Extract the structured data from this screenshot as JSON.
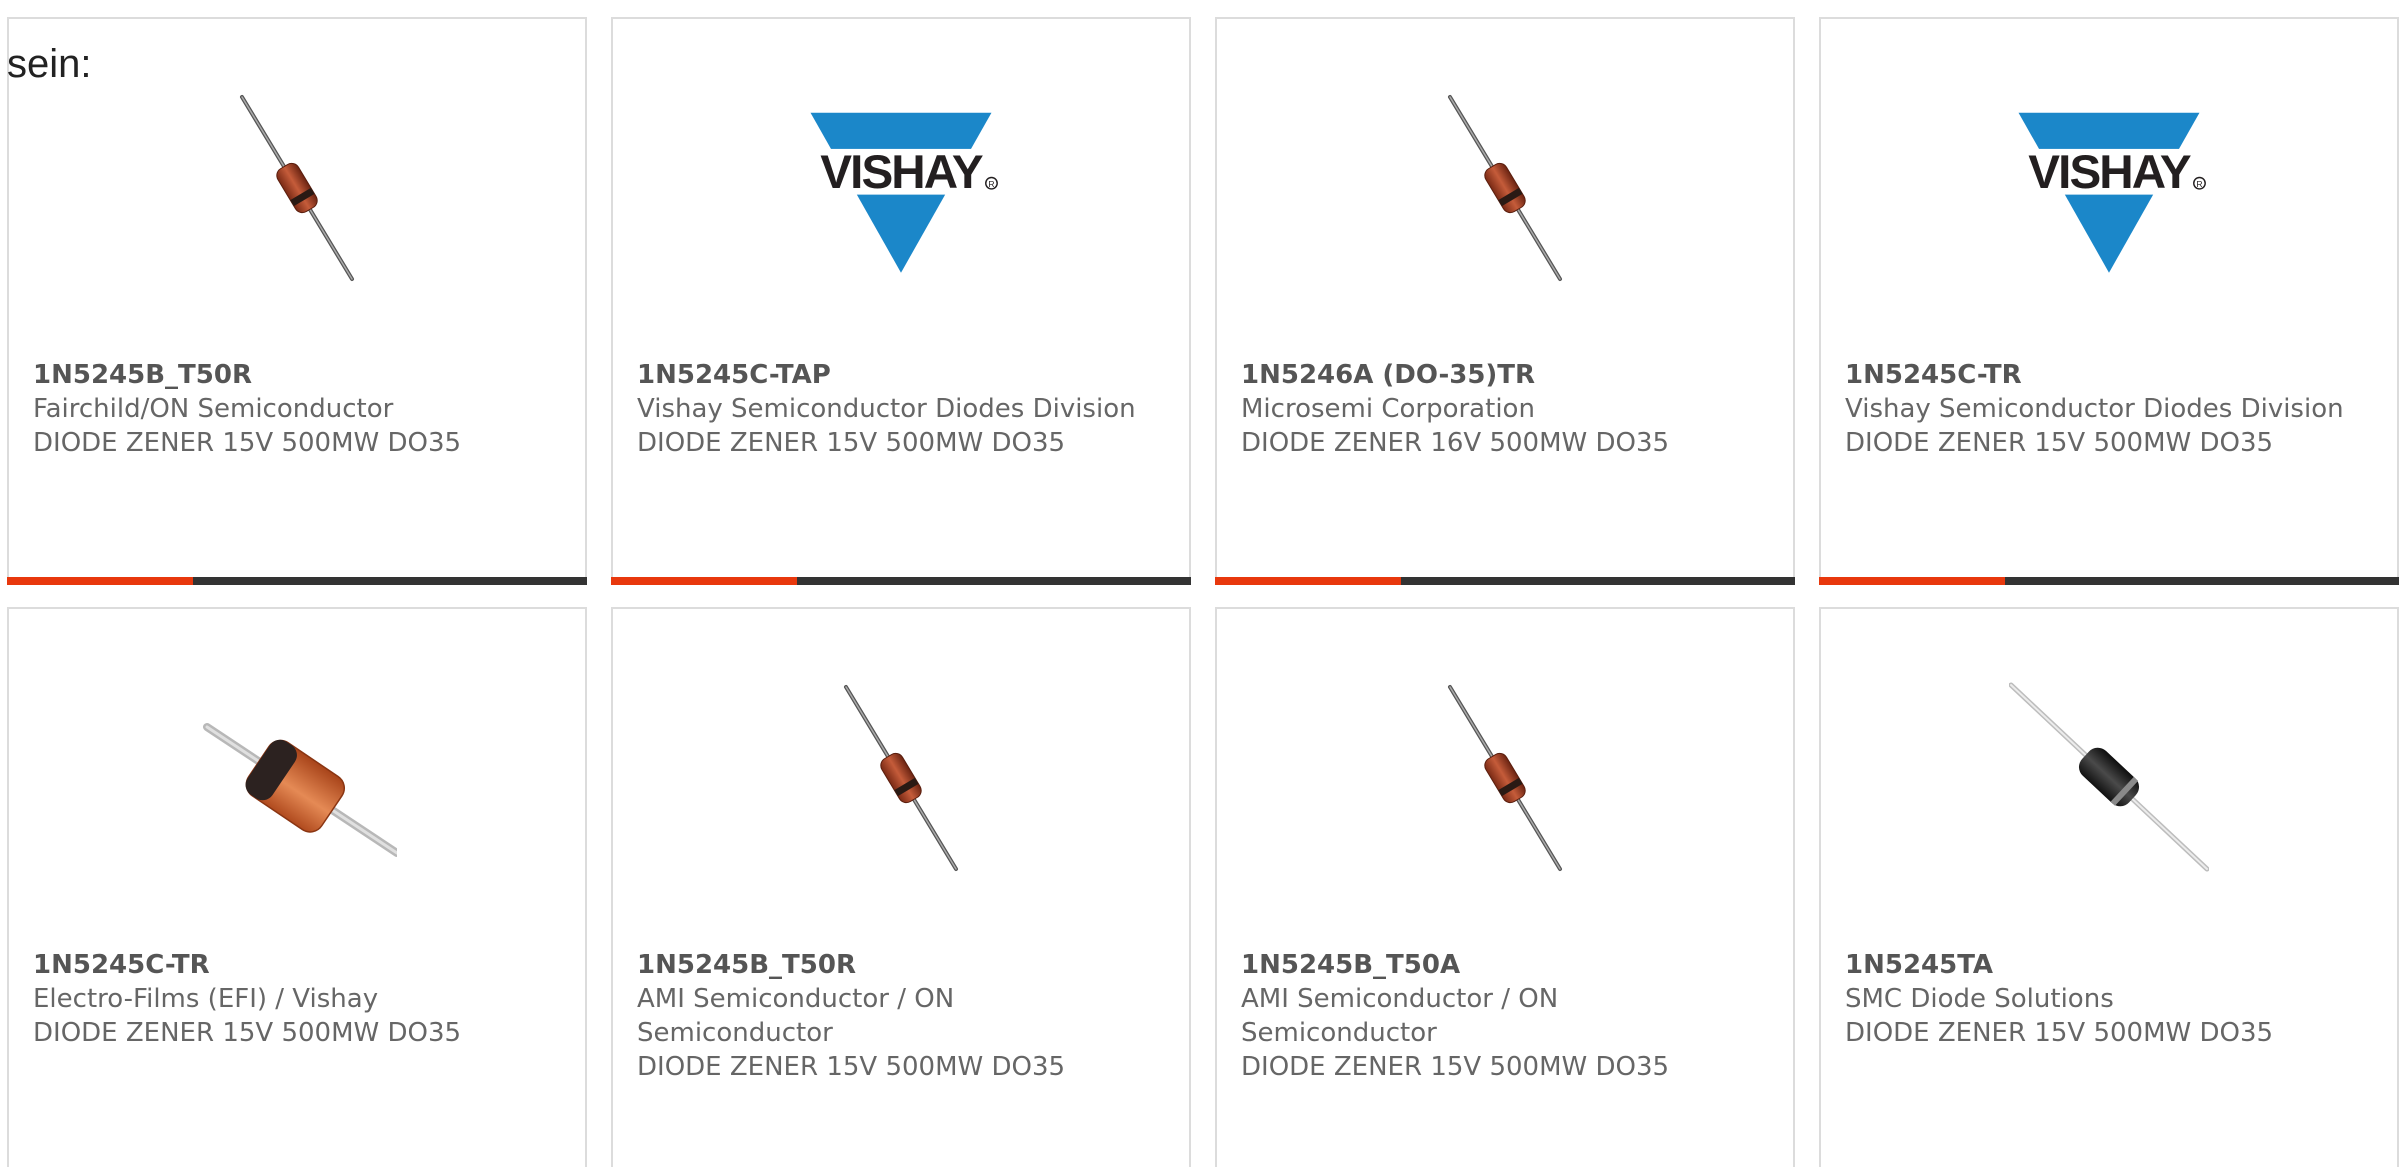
{
  "intro_text": "sein:",
  "colors": {
    "accent": "#e8380d",
    "bar_dark": "#333333",
    "card_border": "#dcdcdc",
    "vishay_blue": "#1b87c9"
  },
  "accent_bar_fraction": 0.32,
  "products": [
    {
      "part_number": "1N5245B_T50R",
      "manufacturer": "Fairchild/ON Semiconductor",
      "description": "DIODE ZENER 15V 500MW DO35",
      "image": "diode-do35-thin-icon"
    },
    {
      "part_number": "1N5245C-TAP",
      "manufacturer": "Vishay Semiconductor Diodes Division",
      "description": "DIODE ZENER 15V 500MW DO35",
      "image": "vishay-logo",
      "logo_text": "VISHAY"
    },
    {
      "part_number": "1N5246A (DO-35)TR",
      "manufacturer": "Microsemi Corporation",
      "description": "DIODE ZENER 16V 500MW DO35",
      "image": "diode-do35-thin-icon"
    },
    {
      "part_number": "1N5245C-TR",
      "manufacturer": "Vishay Semiconductor Diodes Division",
      "description": "DIODE ZENER 15V 500MW DO35",
      "image": "vishay-logo",
      "logo_text": "VISHAY"
    },
    {
      "part_number": "1N5245C-TR",
      "manufacturer": "Electro-Films (EFI) / Vishay",
      "description": "DIODE ZENER 15V 500MW DO35",
      "image": "diode-glass-large-icon"
    },
    {
      "part_number": "1N5245B_T50R",
      "manufacturer": "AMI Semiconductor / ON Semiconductor",
      "description": "DIODE ZENER 15V 500MW DO35",
      "image": "diode-do35-thin-icon"
    },
    {
      "part_number": "1N5245B_T50A",
      "manufacturer": "AMI Semiconductor / ON Semiconductor",
      "description": "DIODE ZENER 15V 500MW DO35",
      "image": "diode-do35-thin-icon"
    },
    {
      "part_number": "1N5245TA",
      "manufacturer": "SMC Diode Solutions",
      "description": "DIODE ZENER 15V 500MW DO35",
      "image": "diode-black-icon"
    }
  ]
}
